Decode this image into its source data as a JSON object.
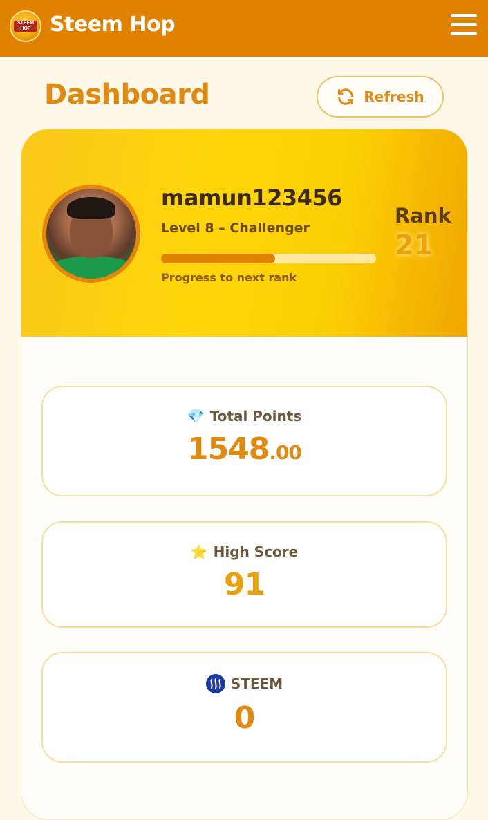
{
  "app": {
    "brand": "Steem Hop",
    "logo_text": "STEEM HOP"
  },
  "header": {
    "title": "Dashboard",
    "refresh_label": "Refresh"
  },
  "profile": {
    "username": "mamun123456",
    "level": "Level 8 – Challenger",
    "progress_fraction": 0.53,
    "progress_label": "Progress to next rank",
    "rank_label": "Rank",
    "rank_value": "21"
  },
  "stats": {
    "points": {
      "icon": "gem-icon",
      "title": "Total Points",
      "value_int": "1548",
      "value_dec": ".00"
    },
    "score": {
      "icon": "star-icon",
      "title": "High Score",
      "value": "91"
    },
    "steem": {
      "icon": "steem-icon",
      "title": "STEEM",
      "value": "0"
    }
  },
  "colors": {
    "topbar": "#e08200",
    "accent": "#e08a12",
    "banner": "#ffd60a"
  }
}
